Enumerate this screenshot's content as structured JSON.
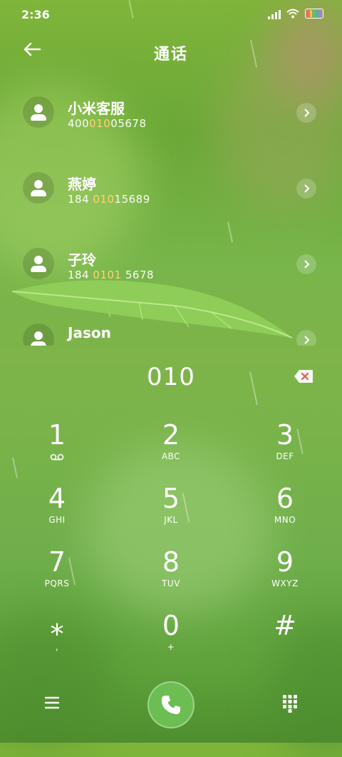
{
  "status_bar": {
    "time": "2:36"
  },
  "header": {
    "title": "通话"
  },
  "contacts": [
    {
      "name": "小米客服",
      "num_pre": "400",
      "num_hl": "010",
      "num_post": "05678"
    },
    {
      "name": "燕婷",
      "num_pre": "184 ",
      "num_hl": "010",
      "num_post": "15689"
    },
    {
      "name": "子玲",
      "num_pre": "184 ",
      "num_hl": "0101",
      "num_post": " 5678"
    },
    {
      "name": "Jason",
      "num_pre": "",
      "num_hl": "",
      "num_post": ""
    }
  ],
  "dialer": {
    "entered": "010",
    "keys": [
      {
        "digit": "1",
        "letters": ""
      },
      {
        "digit": "2",
        "letters": "ABC"
      },
      {
        "digit": "3",
        "letters": "DEF"
      },
      {
        "digit": "4",
        "letters": "GHI"
      },
      {
        "digit": "5",
        "letters": "JKL"
      },
      {
        "digit": "6",
        "letters": "MNO"
      },
      {
        "digit": "7",
        "letters": "PQRS"
      },
      {
        "digit": "8",
        "letters": "TUV"
      },
      {
        "digit": "9",
        "letters": "WXYZ"
      },
      {
        "digit": "⁎",
        "letters": ","
      },
      {
        "digit": "0",
        "letters": "+"
      },
      {
        "digit": "#",
        "letters": ""
      }
    ]
  },
  "icons": {
    "back": "arrow-left-icon",
    "voicemail": "voicemail-icon",
    "delete": "backspace-icon",
    "menu": "menu-icon",
    "call": "phone-icon",
    "keypad": "keypad-icon"
  },
  "colors": {
    "highlight": "#ffd27a",
    "call_button": "#6cbd52",
    "delete_icon": "#e05a5a"
  }
}
